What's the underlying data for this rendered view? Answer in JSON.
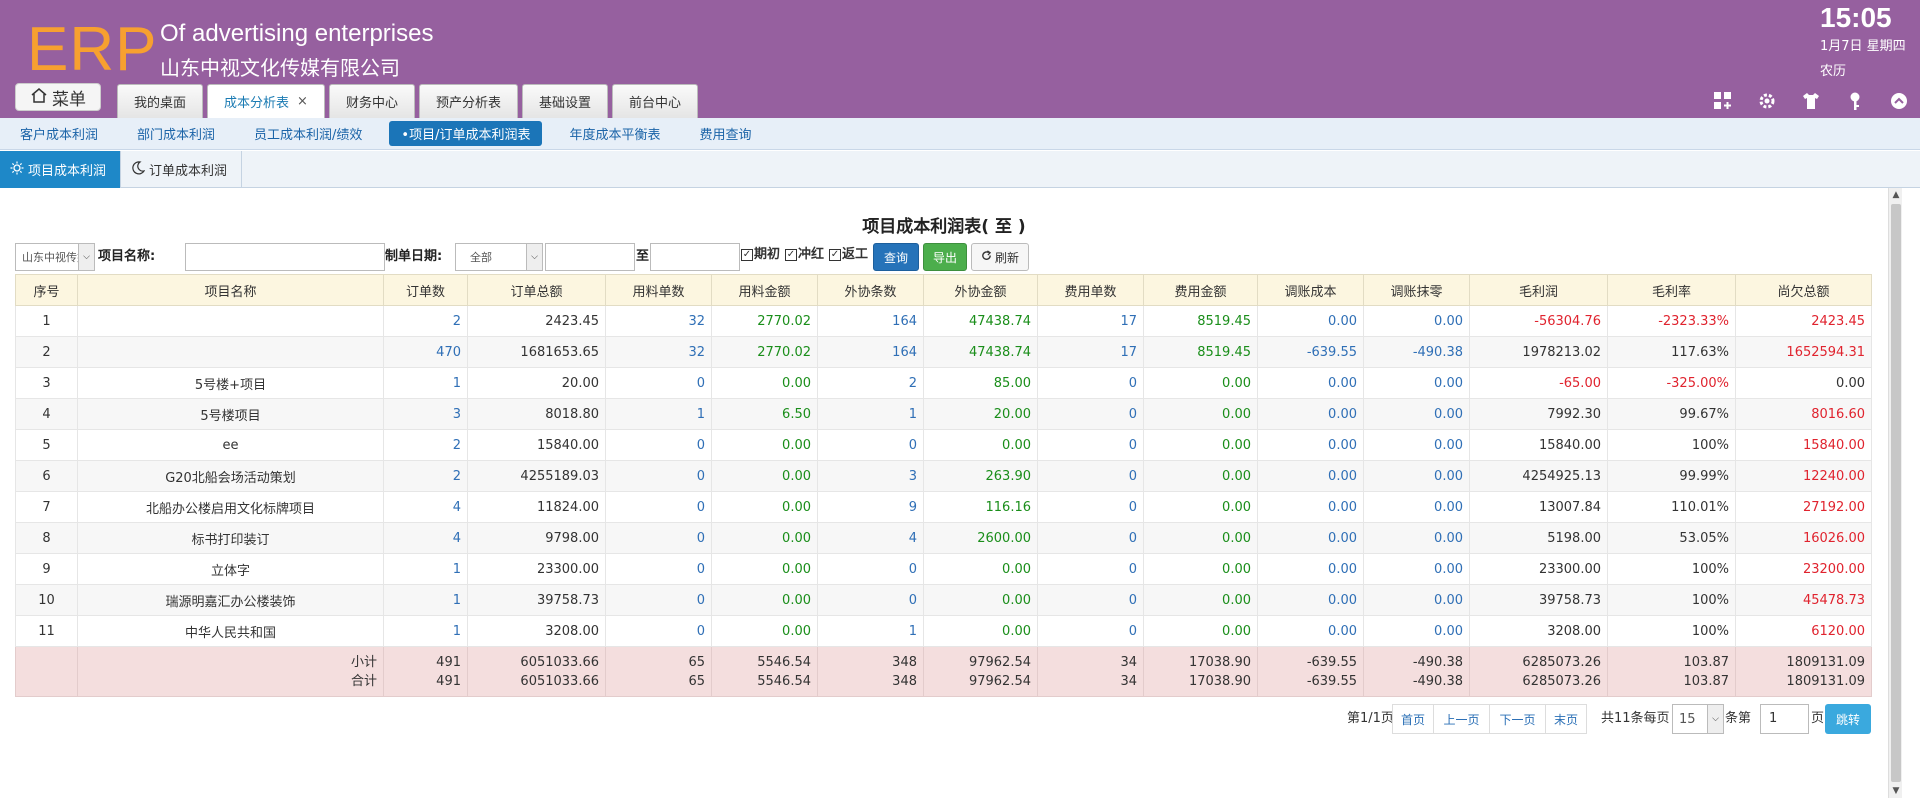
{
  "header": {
    "logo": "ERP",
    "brand_en": "Of advertising enterprises",
    "brand_cn": "山东中视文化传媒有限公司",
    "time": "15:05",
    "date": "1月7日 星期四",
    "lunar": "农历",
    "menu_label": "菜单",
    "tabs": [
      {
        "label": "我的桌面"
      },
      {
        "label": "成本分析表",
        "close": "×"
      },
      {
        "label": "财务中心"
      },
      {
        "label": "预产分析表"
      },
      {
        "label": "基础设置"
      },
      {
        "label": "前台中心"
      }
    ],
    "icons": [
      "grid-add-icon",
      "gear-icon",
      "shirt-icon",
      "key-icon",
      "chevron-up-icon"
    ]
  },
  "subnav": [
    "客户成本利润",
    "部门成本利润",
    "员工成本利润/绩效",
    "•项目/订单成本利润表",
    "年度成本平衡表",
    "费用查询"
  ],
  "inner_tabs": [
    {
      "label": "项目成本利润"
    },
    {
      "label": "订单成本利润"
    }
  ],
  "report": {
    "title": "项目成本利润表( 至 )",
    "filters": {
      "company_select": "山东中视传媒",
      "project_name_label": "项目名称:",
      "date_label": "制单日期:",
      "date_select": "全部",
      "to_label": "至",
      "chk_initial": "期初",
      "chk_reverse": "冲红",
      "chk_rework": "返工",
      "query_btn": "查询",
      "export_btn": "导出",
      "refresh_btn": "刷新"
    },
    "columns": [
      "序号",
      "项目名称",
      "订单数",
      "订单总额",
      "用料单数",
      "用料金额",
      "外协条数",
      "外协金额",
      "费用单数",
      "费用金额",
      "调账成本",
      "调账抹零",
      "毛利润",
      "毛利率",
      "尚欠总额"
    ],
    "rows": [
      {
        "no": "1",
        "name": "",
        "orders": "2",
        "order_total": "2423.45",
        "mat_cnt": "32",
        "mat_amt": "2770.02",
        "out_cnt": "164",
        "out_amt": "47438.74",
        "fee_cnt": "17",
        "fee_amt": "8519.45",
        "adj_cost": "0.00",
        "adj_round": "0.00",
        "profit": "-56304.76",
        "rate": "-2323.33%",
        "owed": "2423.45"
      },
      {
        "no": "2",
        "name": "",
        "orders": "470",
        "order_total": "1681653.65",
        "mat_cnt": "32",
        "mat_amt": "2770.02",
        "out_cnt": "164",
        "out_amt": "47438.74",
        "fee_cnt": "17",
        "fee_amt": "8519.45",
        "adj_cost": "-639.55",
        "adj_round": "-490.38",
        "profit": "1978213.02",
        "rate": "117.63%",
        "owed": "1652594.31"
      },
      {
        "no": "3",
        "name": "5号楼+项目",
        "orders": "1",
        "order_total": "20.00",
        "mat_cnt": "0",
        "mat_amt": "0.00",
        "out_cnt": "2",
        "out_amt": "85.00",
        "fee_cnt": "0",
        "fee_amt": "0.00",
        "adj_cost": "0.00",
        "adj_round": "0.00",
        "profit": "-65.00",
        "rate": "-325.00%",
        "owed": "0.00"
      },
      {
        "no": "4",
        "name": "5号楼项目",
        "orders": "3",
        "order_total": "8018.80",
        "mat_cnt": "1",
        "mat_amt": "6.50",
        "out_cnt": "1",
        "out_amt": "20.00",
        "fee_cnt": "0",
        "fee_amt": "0.00",
        "adj_cost": "0.00",
        "adj_round": "0.00",
        "profit": "7992.30",
        "rate": "99.67%",
        "owed": "8016.60"
      },
      {
        "no": "5",
        "name": "ee",
        "orders": "2",
        "order_total": "15840.00",
        "mat_cnt": "0",
        "mat_amt": "0.00",
        "out_cnt": "0",
        "out_amt": "0.00",
        "fee_cnt": "0",
        "fee_amt": "0.00",
        "adj_cost": "0.00",
        "adj_round": "0.00",
        "profit": "15840.00",
        "rate": "100%",
        "owed": "15840.00"
      },
      {
        "no": "6",
        "name": "G20北船会场活动策划",
        "orders": "2",
        "order_total": "4255189.03",
        "mat_cnt": "0",
        "mat_amt": "0.00",
        "out_cnt": "3",
        "out_amt": "263.90",
        "fee_cnt": "0",
        "fee_amt": "0.00",
        "adj_cost": "0.00",
        "adj_round": "0.00",
        "profit": "4254925.13",
        "rate": "99.99%",
        "owed": "12240.00"
      },
      {
        "no": "7",
        "name": "北船办公楼启用文化标牌项目",
        "orders": "4",
        "order_total": "11824.00",
        "mat_cnt": "0",
        "mat_amt": "0.00",
        "out_cnt": "9",
        "out_amt": "116.16",
        "fee_cnt": "0",
        "fee_amt": "0.00",
        "adj_cost": "0.00",
        "adj_round": "0.00",
        "profit": "13007.84",
        "rate": "110.01%",
        "owed": "27192.00"
      },
      {
        "no": "8",
        "name": "标书打印装订",
        "orders": "4",
        "order_total": "9798.00",
        "mat_cnt": "0",
        "mat_amt": "0.00",
        "out_cnt": "4",
        "out_amt": "2600.00",
        "fee_cnt": "0",
        "fee_amt": "0.00",
        "adj_cost": "0.00",
        "adj_round": "0.00",
        "profit": "5198.00",
        "rate": "53.05%",
        "owed": "16026.00"
      },
      {
        "no": "9",
        "name": "立体字",
        "orders": "1",
        "order_total": "23300.00",
        "mat_cnt": "0",
        "mat_amt": "0.00",
        "out_cnt": "0",
        "out_amt": "0.00",
        "fee_cnt": "0",
        "fee_amt": "0.00",
        "adj_cost": "0.00",
        "adj_round": "0.00",
        "profit": "23300.00",
        "rate": "100%",
        "owed": "23200.00"
      },
      {
        "no": "10",
        "name": "瑞源明嘉汇办公楼装饰",
        "orders": "1",
        "order_total": "39758.73",
        "mat_cnt": "0",
        "mat_amt": "0.00",
        "out_cnt": "0",
        "out_amt": "0.00",
        "fee_cnt": "0",
        "fee_amt": "0.00",
        "adj_cost": "0.00",
        "adj_round": "0.00",
        "profit": "39758.73",
        "rate": "100%",
        "owed": "45478.73"
      },
      {
        "no": "11",
        "name": "中华人民共和国",
        "orders": "1",
        "order_total": "3208.00",
        "mat_cnt": "0",
        "mat_amt": "0.00",
        "out_cnt": "1",
        "out_amt": "0.00",
        "fee_cnt": "0",
        "fee_amt": "0.00",
        "adj_cost": "0.00",
        "adj_round": "0.00",
        "profit": "3208.00",
        "rate": "100%",
        "owed": "6120.00"
      }
    ],
    "totals": {
      "subtotal_label": "小计",
      "total_label": "合计",
      "subtotal": [
        "491",
        "6051033.66",
        "65",
        "5546.54",
        "348",
        "97962.54",
        "34",
        "17038.90",
        "-639.55",
        "-490.38",
        "6285073.26",
        "103.87",
        "1809131.09"
      ],
      "total": [
        "491",
        "6051033.66",
        "65",
        "5546.54",
        "348",
        "97962.54",
        "34",
        "17038.90",
        "-639.55",
        "-490.38",
        "6285073.26",
        "103.87",
        "1809131.09"
      ]
    },
    "pager": {
      "page_info": "第1/1页",
      "first": "首页",
      "prev": "上一页",
      "next": "下一页",
      "last": "末页",
      "count_text": "共11条每页",
      "page_size": "15",
      "goto_prefix": "条第",
      "goto_value": "1",
      "goto_suffix": "页",
      "jump": "跳转"
    }
  },
  "colors": {
    "header_bg": "#96609f",
    "logo": "#f7a030",
    "link_blue": "#2f6fb6",
    "positive_green": "#1a8e1a",
    "negative_red": "#e0232e"
  }
}
